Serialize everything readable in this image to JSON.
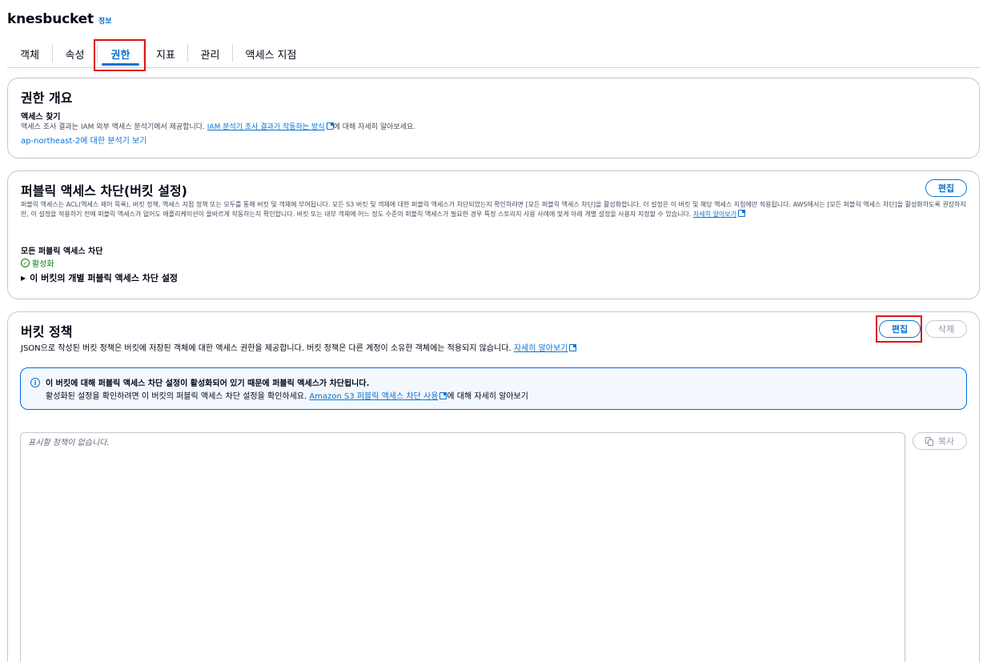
{
  "header": {
    "bucket_name": "knesbucket",
    "info": "정보"
  },
  "tabs": [
    {
      "label": "객체"
    },
    {
      "label": "속성"
    },
    {
      "label": "권한"
    },
    {
      "label": "지표"
    },
    {
      "label": "관리"
    },
    {
      "label": "액세스 지점"
    }
  ],
  "overview": {
    "title": "권한 개요",
    "access_finder_title": "액세스 찾기",
    "description_prefix": "액세스 조사 결과는 IAM 외부 액세스 분석기에서 제공합니다. ",
    "description_link": "IAM 분석기 조사 결과가 작동하는 방식",
    "description_suffix": "에 대해 자세히 알아보세요.",
    "analyzer_link": "ap-northeast-2에 대한 분석기 보기"
  },
  "public_access": {
    "title": "퍼블릭 액세스 차단(버킷 설정)",
    "edit_label": "편집",
    "description": "퍼블릭 액세스는 ACL(액세스 제어 목록), 버킷 정책, 액세스 지점 정책 또는 모두를 통해 버킷 및 객체에 부여됩니다. 모든 S3 버킷 및 객체에 대한 퍼블릭 액세스가 차단되었는지 확인하려면 [모든 퍼블릭 액세스 차단]을 활성화합니다. 이 설정은 이 버킷 및 해당 액세스 지점에만 적용됩니다. AWS에서는 [모든 퍼블릭 액세스 차단]을 활성화하도록 권장하지만, 이 설정을 적용하기 전에 퍼블릭 액세스가 없어도 애플리케이션이 올바르게 작동하는지 확인합니다. 버킷 또는 내부 객체에 어느 정도 수준의 퍼블릭 액세스가 필요한 경우 특정 스토리지 사용 사례에 맞게 아래 개별 설정을 사용자 지정할 수 있습니다.",
    "learn_more": "자세히 알아보기",
    "block_all_label": "모든 퍼블릭 액세스 차단",
    "status": "활성화",
    "individual_settings": "이 버킷의 개별 퍼블릭 액세스 차단 설정"
  },
  "bucket_policy": {
    "title": "버킷 정책",
    "edit_label": "편집",
    "delete_label": "삭제",
    "description": "JSON으로 작성된 버킷 정책은 버킷에 저장된 객체에 대한 액세스 권한을 제공합니다. 버킷 정책은 다른 계정이 소유한 객체에는 적용되지 않습니다. ",
    "learn_more": "자세히 알아보기",
    "alert_title": "이 버킷에 대해 퍼블릭 액세스 차단 설정이 활성화되어 있기 때문에 퍼블릭 액세스가 차단됩니다.",
    "alert_body_prefix": "활성화된 설정을 확인하려면 이 버킷의 퍼블릭 액세스 차단 설정을 확인하세요. ",
    "alert_link": "Amazon S3 퍼블릭 액세스 차단 사용",
    "alert_body_suffix": "에 대해 자세히 알아보기",
    "editor_placeholder": "표시할 정책이 없습니다.",
    "copy_label": "복사"
  },
  "colors": {
    "accent": "#0972d3",
    "success": "#037f0c",
    "highlight": "#d91515"
  }
}
